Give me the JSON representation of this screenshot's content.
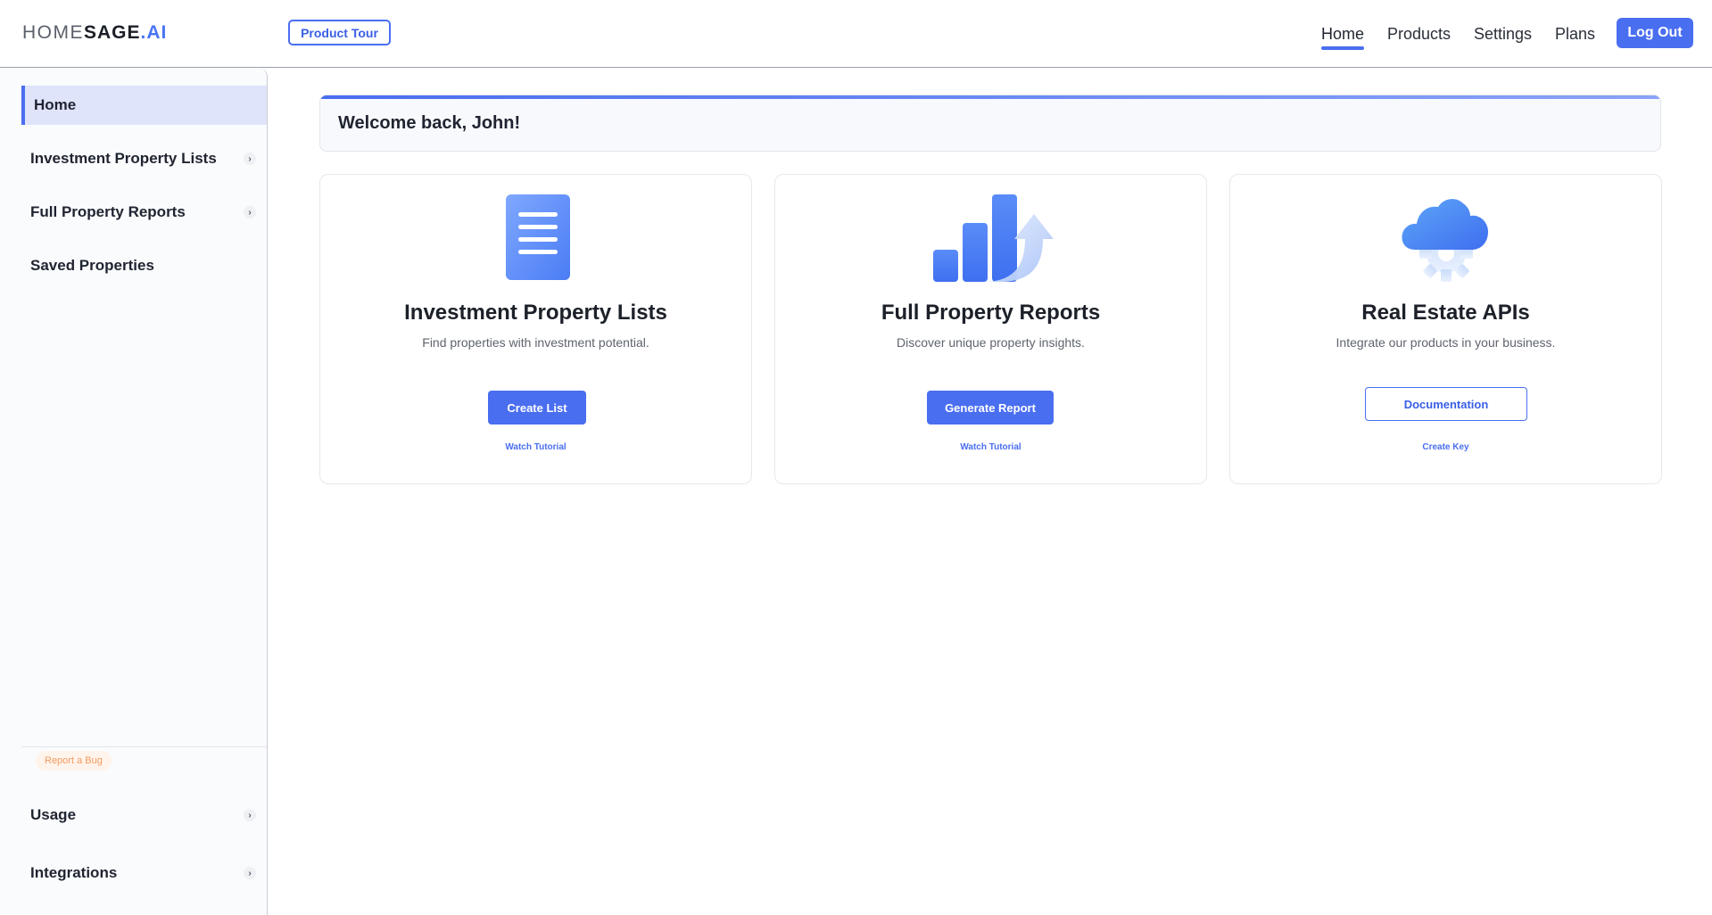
{
  "header": {
    "logo": {
      "part1": "HOME",
      "part2": "SAGE",
      "part3": ".AI"
    },
    "product_tour": "Product Tour",
    "nav": [
      "Home",
      "Products",
      "Settings",
      "Plans"
    ],
    "logout": "Log Out"
  },
  "sidebar": {
    "items": [
      {
        "label": "Home",
        "active": true
      },
      {
        "label": "Investment Property Lists",
        "expandable": true
      },
      {
        "label": "Full Property Reports",
        "expandable": true
      },
      {
        "label": "Saved Properties"
      }
    ],
    "report_bug": "Report a Bug",
    "bottom_items": [
      {
        "label": "Usage",
        "expandable": true
      },
      {
        "label": "Integrations",
        "expandable": true
      }
    ]
  },
  "main": {
    "welcome": "Welcome back, John!",
    "cards": [
      {
        "icon": "document-list-icon",
        "title": "Investment Property Lists",
        "subtitle": "Find properties with investment potential.",
        "button": "Create List",
        "link": "Watch Tutorial"
      },
      {
        "icon": "bar-chart-growth-icon",
        "title": "Full Property Reports",
        "subtitle": "Discover unique property insights.",
        "button": "Generate Report",
        "link": "Watch Tutorial"
      },
      {
        "icon": "cloud-gear-icon",
        "title": "Real Estate APIs",
        "subtitle": "Integrate our products in your business.",
        "button": "Documentation",
        "link": "Create Key"
      }
    ]
  },
  "colors": {
    "accent": "#4a6ef0",
    "active_bg": "#dfe4fb",
    "bug_text": "#f29a5e"
  }
}
